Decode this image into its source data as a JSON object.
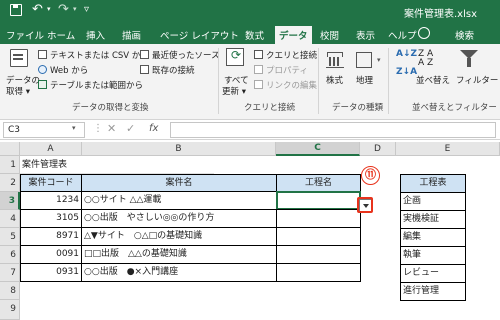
{
  "titlebar": {
    "filename": "案件管理表.xlsx",
    "undo_icon": "undo-icon",
    "redo_icon": "redo-icon"
  },
  "tabs": [
    "ファイル",
    "ホーム",
    "挿入",
    "描画",
    "ページ レイアウト",
    "数式",
    "データ",
    "校閲",
    "表示",
    "ヘルプ"
  ],
  "active_tab": "データ",
  "search_label": "検索",
  "ribbon": {
    "get_data_line1": "データの",
    "get_data_line2": "取得 ▾",
    "text_csv": "テキストまたは CSV から",
    "web": "Web から",
    "table_range": "テーブルまたは範囲から",
    "recent_sources": "最近使ったソース",
    "existing_connections": "既存の接続",
    "group_get_transform": "データの取得と変換",
    "refresh_all_line1": "すべて",
    "refresh_all_line2": "更新 ▾",
    "queries_connections": "クエリと接続",
    "properties": "プロパティ",
    "edit_links": "リンクの編集",
    "group_queries": "クエリと接続",
    "stocks": "株式",
    "geography": "地理",
    "group_data_types": "データの種類",
    "sort": "並べ替え",
    "filter": "フィルター",
    "group_sort_filter": "並べ替えとフィルター"
  },
  "formula_bar": {
    "name_box": "C3",
    "fx": "fx",
    "value": ""
  },
  "columns": [
    "A",
    "B",
    "C",
    "D",
    "E"
  ],
  "rows": [
    "1",
    "2",
    "3",
    "4",
    "5",
    "6",
    "7",
    "8",
    "9"
  ],
  "sheet": {
    "a1": "案件管理表",
    "headers": [
      "案件コード",
      "案件名",
      "工程名"
    ],
    "records": [
      {
        "code": "1234",
        "name": "○○サイト △△運載",
        "process": ""
      },
      {
        "code": "3105",
        "name": "○○出版　やさしい◎◎の作り方",
        "process": ""
      },
      {
        "code": "8971",
        "name": "△▼サイト　○△□の基礎知識",
        "process": ""
      },
      {
        "code": "0091",
        "name": "□□出版　△△の基礎知識",
        "process": ""
      },
      {
        "code": "0931",
        "name": "○○出版　●×入門講座",
        "process": ""
      }
    ],
    "process_table_header": "工程表",
    "process_list": [
      "企画",
      "実機検証",
      "編集",
      "執筆",
      "レビュー",
      "進行管理"
    ]
  },
  "callout_number": "⑪",
  "colors": {
    "excel_green": "#217346",
    "header_fill": "#cfe2f3",
    "callout_red": "#e8331c"
  }
}
